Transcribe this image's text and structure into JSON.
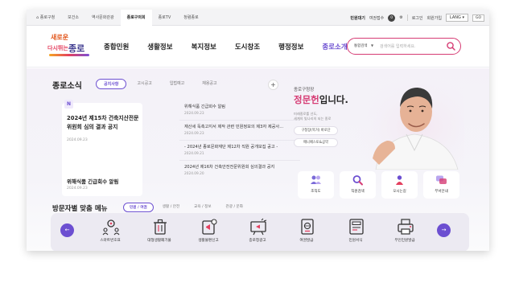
{
  "utility": {
    "tabs": [
      "종로구청",
      "보건소",
      "역사문화관광",
      "종로구의회",
      "종로TV",
      "청렴종로"
    ],
    "waiting_label": "민원대기",
    "waiting_count_label": "여권접수",
    "waiting_count": "0",
    "login": "로그인",
    "join": "회원가입",
    "lang": "LANG ▾",
    "go": "GO"
  },
  "header": {
    "logo_top": "새로운",
    "logo_mid": "다시뛰는",
    "logo_name": "종로",
    "nav": [
      "종합민원",
      "생활정보",
      "복지정보",
      "도시창조",
      "행정정보",
      "종로소개"
    ],
    "search": {
      "category": "통합검색",
      "placeholder": "검색어를 입력하세요."
    }
  },
  "news": {
    "title": "종로소식",
    "tabs": [
      "공지사항",
      "고시공고",
      "입법예고",
      "채용공고"
    ],
    "plus": "+",
    "featured": [
      {
        "badge": "N",
        "title": "2024년 제15차 건축지산전문위원회 심의 결과 공지",
        "date": "2024.09.23"
      },
      {
        "title": "위해식품 긴급회수 알림",
        "date": "2024.09.23"
      }
    ],
    "list": [
      {
        "title": "위해식품 긴급회수 알림",
        "date": "2024.09.23"
      },
      {
        "title": "재산세 독촉고지서 제작 관련 민원정보의 제3자 제공사...",
        "date": "2024.09.23"
      },
      {
        "title": "- 2024년 종로문화재단 제12차 직원 공개모집 공고 -",
        "date": "2024.09.21"
      },
      {
        "title": "2024년 제16차 건축안전전문위원회 심의결과 공지",
        "date": "2024.09.20"
      }
    ]
  },
  "mayor": {
    "label": "종로구청장",
    "name": "정문헌",
    "suffix": "입니다.",
    "desc": "미래종로를 선도,\n세계의 빛나리의 되는 종로",
    "buttons": [
      "구청장(목거) 바로단",
      "매니페스토&공약"
    ]
  },
  "quick": [
    {
      "icon": "people-icon",
      "label": "조직도"
    },
    {
      "icon": "magnifier-icon",
      "label": "직원검색"
    },
    {
      "icon": "location-person-icon",
      "label": "오시는길"
    },
    {
      "icon": "chat-icon",
      "label": "부서안내"
    }
  ],
  "visitor": {
    "title": "방문자별 맞춤 메뉴",
    "tabs": [
      "민원 / 여권",
      "생활 / 안전",
      "교육 / 정보",
      "관광 / 문화"
    ],
    "prev": "←",
    "next": "→",
    "services": [
      {
        "icon": "gears-people-icon",
        "label": "스마트번호표"
      },
      {
        "icon": "trash-bin-icon",
        "label": "대형생활폐기물"
      },
      {
        "icon": "report-megaphone-icon",
        "label": "생활불편신고"
      },
      {
        "icon": "board-megaphone-icon",
        "label": "종로청광고"
      },
      {
        "icon": "passport-icon",
        "label": "여권발급"
      },
      {
        "icon": "document-form-icon",
        "label": "민원서식"
      },
      {
        "icon": "printer-icon",
        "label": "무인민원발급"
      }
    ]
  },
  "colors": {
    "accent": "#6c4fd1",
    "pink": "#d63c74",
    "orange": "#e2561b"
  }
}
